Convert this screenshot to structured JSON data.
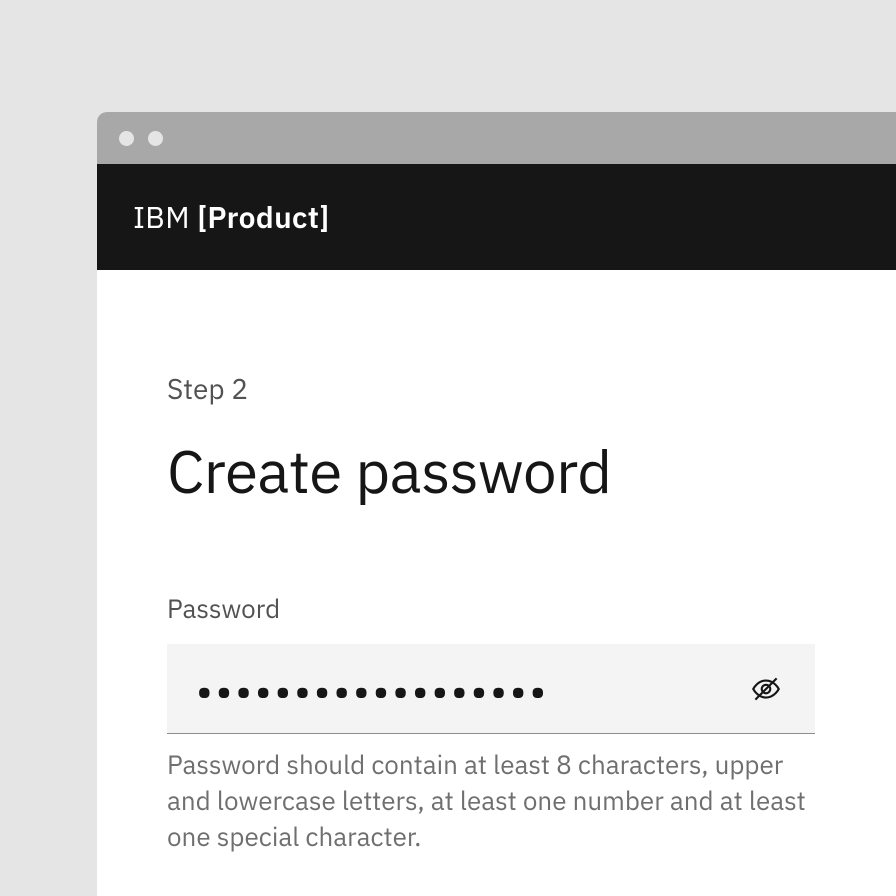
{
  "brand": {
    "prefix": "IBM ",
    "product": "[Product]"
  },
  "form": {
    "step_label": "Step 2",
    "title": "Create password",
    "password": {
      "label": "Password",
      "value_masked": "••••••••••••••••••",
      "helper": "Password should contain at least 8 characters, upper and lowercase letters, at least one number and at least one special character."
    }
  },
  "colors": {
    "bg": "#e5e5e5",
    "titlebar": "#a8a8a8",
    "header": "#161616",
    "text_primary": "#161616",
    "text_secondary": "#525252",
    "text_helper": "#6f6f6f",
    "field_bg": "#f4f4f4",
    "field_border": "#8d8d8d"
  }
}
